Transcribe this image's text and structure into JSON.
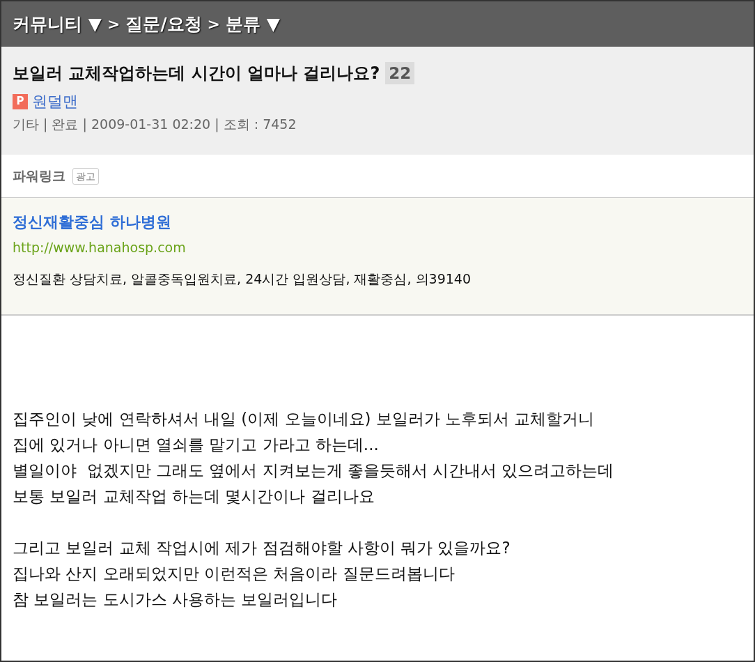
{
  "breadcrumb": [
    {
      "text": "커뮤니티 ▼",
      "kind": "link"
    },
    {
      "text": ">",
      "kind": "sep"
    },
    {
      "text": "질문/요청",
      "kind": "link"
    },
    {
      "text": ">",
      "kind": "sep"
    },
    {
      "text": "분류 ▼",
      "kind": "link"
    }
  ],
  "post": {
    "title": "보일러 교체작업하는데 시간이 얼마나 걸리나요?",
    "comment_count": "22",
    "author": {
      "badge": "P",
      "name": "원덜맨"
    },
    "meta": "기타 | 완료 | 2009-01-31 02:20 | 조회 : 7452"
  },
  "powerlink": {
    "label": "파워링크",
    "tag": "광고"
  },
  "ad": {
    "title": "정신재활중심 하나병원",
    "url": "http://www.hanahosp.com",
    "description": "정신질환 상담치료, 알콜중독입원치료, 24시간 입원상담, 재활중심, 의39140"
  },
  "body": [
    [
      "집주인이 낮에 연락하셔서 내일 (이제 오늘이네요) 보일러가 노후되서 교체할거니",
      "집에 있거나 아니면 열쇠를 맡기고 가라고 하는데...",
      "별일이야  없겠지만 그래도 옆에서 지켜보는게 좋을듯해서 시간내서 있으려고하는데",
      "보통 보일러 교체작업 하는데 몇시간이나 걸리나요"
    ],
    [
      "그리고 보일러 교체 작업시에 제가 점검해야할 사항이 뭐가 있을까요?",
      "집나와 산지 오래되었지만 이런적은 처음이라 질문드려봅니다",
      "참 보일러는 도시가스 사용하는 보일러입니다"
    ]
  ]
}
